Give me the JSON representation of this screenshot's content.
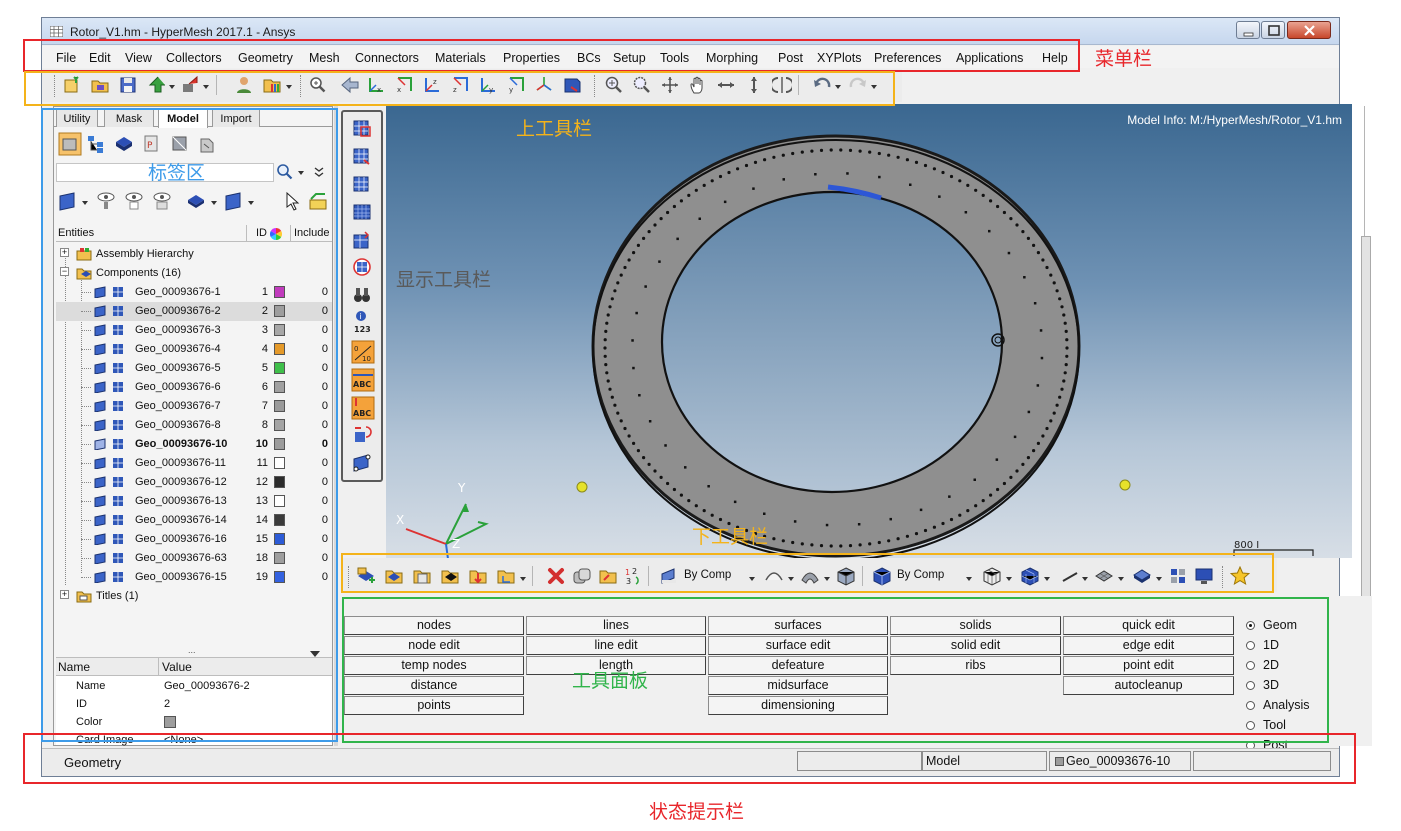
{
  "window": {
    "title": "Rotor_V1.hm - HyperMesh 2017.1 - Ansys",
    "controls": [
      "minimize",
      "maximize",
      "close"
    ]
  },
  "menubar": {
    "items": [
      "File",
      "Edit",
      "View",
      "Collectors",
      "Geometry",
      "Mesh",
      "Connectors",
      "Materials",
      "Properties",
      "BCs",
      "Setup",
      "Tools",
      "Morphing",
      "Post",
      "XYPlots",
      "Preferences",
      "Applications",
      "Help"
    ]
  },
  "browser": {
    "tabs": [
      "Utility",
      "Mask",
      "Model",
      "Import"
    ],
    "active_tab": "Model",
    "columns": {
      "entities": "Entities",
      "id": "ID",
      "include": "Include"
    },
    "assembly": "Assembly Hierarchy",
    "components_label": "Components (16)",
    "components": [
      {
        "name": "Geo_00093676-1",
        "id": "1",
        "color": "#c13bbd",
        "include": "0"
      },
      {
        "name": "Geo_00093676-2",
        "id": "2",
        "color": "#9e9e9e",
        "include": "0"
      },
      {
        "name": "Geo_00093676-3",
        "id": "3",
        "color": "#a8a8a8",
        "include": "0"
      },
      {
        "name": "Geo_00093676-4",
        "id": "4",
        "color": "#e59a2a",
        "include": "0"
      },
      {
        "name": "Geo_00093676-5",
        "id": "5",
        "color": "#3fbf4a",
        "include": "0"
      },
      {
        "name": "Geo_00093676-6",
        "id": "6",
        "color": "#a0a0a0",
        "include": "0"
      },
      {
        "name": "Geo_00093676-7",
        "id": "7",
        "color": "#9a9a9a",
        "include": "0"
      },
      {
        "name": "Geo_00093676-8",
        "id": "8",
        "color": "#a4a4a4",
        "include": "0"
      },
      {
        "name": "Geo_00093676-10",
        "id": "10",
        "color": "#9c9c9c",
        "include": "0"
      },
      {
        "name": "Geo_00093676-11",
        "id": "11",
        "color": "#ffffff",
        "include": "0"
      },
      {
        "name": "Geo_00093676-12",
        "id": "12",
        "color": "#2b2b2b",
        "include": "0"
      },
      {
        "name": "Geo_00093676-13",
        "id": "13",
        "color": "#ffffff",
        "include": "0"
      },
      {
        "name": "Geo_00093676-14",
        "id": "14",
        "color": "#3a3a3a",
        "include": "0"
      },
      {
        "name": "Geo_00093676-16",
        "id": "15",
        "color": "#2c5bd6",
        "include": "0"
      },
      {
        "name": "Geo_00093676-63",
        "id": "18",
        "color": "#9e9e9e",
        "include": "0"
      },
      {
        "name": "Geo_00093676-15",
        "id": "19",
        "color": "#3462e0",
        "include": "0"
      }
    ],
    "selected_index": 1,
    "bold_index": 8,
    "titles_label": "Titles (1)"
  },
  "properties": {
    "header": {
      "name": "Name",
      "value": "Value"
    },
    "rows": [
      {
        "name": "Name",
        "value": "Geo_00093676-2"
      },
      {
        "name": "ID",
        "value": "2"
      },
      {
        "name": "Color",
        "value": "",
        "swatch": "#9e9e9e"
      },
      {
        "name": "Card Image",
        "value": "<None>"
      }
    ]
  },
  "viewport": {
    "model_info": "Model Info: M:/HyperMesh/Rotor_V1.hm",
    "axis_x": "X",
    "axis_y": "Y",
    "axis_z": "Z",
    "scale_label": "800 I"
  },
  "lower_toolbar": {
    "color_mode_1": "By Comp",
    "color_mode_2": "By Comp"
  },
  "panel": {
    "columns": [
      [
        "nodes",
        "node edit",
        "temp nodes",
        "distance",
        "points"
      ],
      [
        "lines",
        "line edit",
        "length",
        "",
        ""
      ],
      [
        "surfaces",
        "surface edit",
        "defeature",
        "midsurface",
        "dimensioning"
      ],
      [
        "solids",
        "solid edit",
        "ribs",
        "",
        ""
      ],
      [
        "quick edit",
        "edge edit",
        "point edit",
        "autocleanup",
        ""
      ]
    ],
    "page_options": [
      "Geom",
      "1D",
      "2D",
      "3D",
      "Analysis",
      "Tool",
      "Post"
    ],
    "selected_option": "Geom"
  },
  "statusbar": {
    "message": "Geometry",
    "field_1": "",
    "model": "Model",
    "component": "Geo_00093676-10",
    "field_4": ""
  },
  "annotations": {
    "menubar": "菜单栏",
    "top_toolbar": "上工具栏",
    "tab_area": "标签区",
    "display_toolbar": "显示工具栏",
    "lower_toolbar": "下工具栏",
    "tool_panel": "工具面板",
    "status_bar": "状态提示栏"
  },
  "colors": {
    "annotation_red": "#e8262b",
    "annotation_orange": "#f4b31a",
    "annotation_blue": "#3d9be9",
    "annotation_green": "#31b44b",
    "viewport_top": "#3a6790",
    "viewport_bottom": "#d7dee6"
  }
}
